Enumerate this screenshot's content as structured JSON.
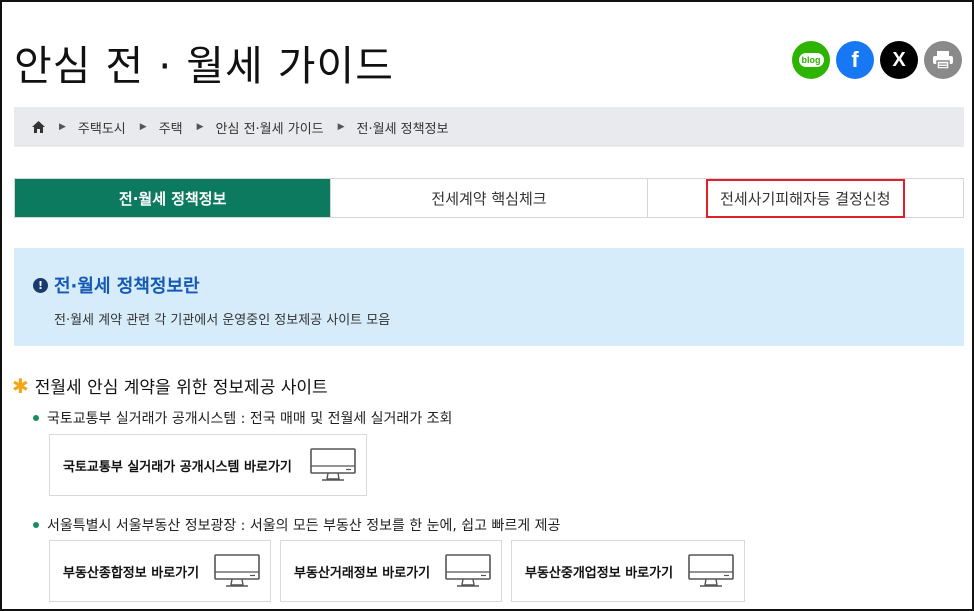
{
  "header": {
    "title": "안심 전 · 월세 가이드",
    "social": [
      {
        "name": "blog",
        "label": "blog",
        "color": "#2db400"
      },
      {
        "name": "facebook",
        "label": "f",
        "color": "#1877f2"
      },
      {
        "name": "x",
        "label": "X",
        "color": "#000000"
      },
      {
        "name": "print",
        "icon": "printer-icon",
        "color": "#8a8a8a"
      }
    ]
  },
  "breadcrumb": {
    "home_icon": "home-icon",
    "items": [
      "주택도시",
      "주택",
      "안심 전·월세 가이드",
      "전·월세 정책정보"
    ]
  },
  "tabs": [
    {
      "label": "전·월세 정책정보",
      "active": true
    },
    {
      "label": "전세계약 핵심체크",
      "active": false
    },
    {
      "label": "전세사기피해자등 결정신청",
      "active": false,
      "highlighted": true
    }
  ],
  "info": {
    "title": "전·월세 정책정보란",
    "description": "전·월세 계약 관련 각 기관에서 운영중인 정보제공 사이트 모음"
  },
  "section": {
    "title": "전월세 안심 계약을 위한 정보제공 사이트",
    "groups": [
      {
        "bullet": "국토교통부 실거래가 공개시스템 : 전국 매매 및 전월세 실거래가 조회",
        "links": [
          "국토교통부 실거래가 공개시스템 바로가기"
        ]
      },
      {
        "bullet": "서울특별시 서울부동산 정보광장 : 서울의 모든 부동산 정보를 한 눈에, 쉽고 빠르게 제공",
        "links": [
          "부동산종합정보 바로가기",
          "부동산거래정보 바로가기",
          "부동산중개업정보 바로가기"
        ]
      }
    ]
  },
  "colors": {
    "accent_green": "#0b7a5e",
    "info_bg": "#d7ecfa",
    "info_title": "#1459b4",
    "highlight_red": "#e3202a"
  }
}
